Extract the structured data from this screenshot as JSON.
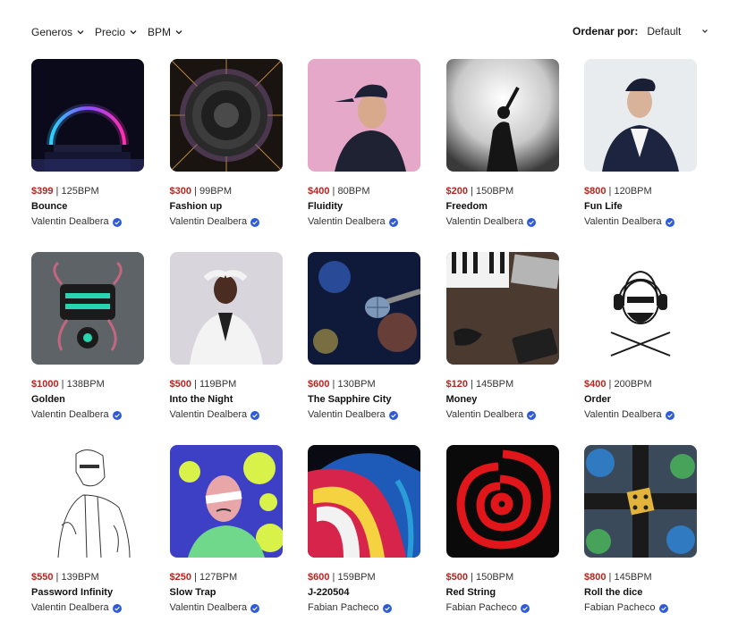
{
  "filters": [
    {
      "label": "Generos"
    },
    {
      "label": "Precio"
    },
    {
      "label": "BPM"
    }
  ],
  "sort": {
    "label": "Ordenar por:",
    "value": "Default"
  },
  "colors": {
    "price": "#b3261e",
    "verified": "#2d5bd7"
  },
  "beats": [
    {
      "price": "$399",
      "bpm": "125BPM",
      "title": "Bounce",
      "author": "Valentin Dealbera",
      "cover": "neon-arch"
    },
    {
      "price": "$300",
      "bpm": "99BPM",
      "title": "Fashion up",
      "author": "Valentin Dealbera",
      "cover": "speaker"
    },
    {
      "price": "$400",
      "bpm": "80BPM",
      "title": "Fluidity",
      "author": "Valentin Dealbera",
      "cover": "man-pink"
    },
    {
      "price": "$200",
      "bpm": "150BPM",
      "title": "Freedom",
      "author": "Valentin Dealbera",
      "cover": "singer-light"
    },
    {
      "price": "$800",
      "bpm": "120BPM",
      "title": "Fun Life",
      "author": "Valentin Dealbera",
      "cover": "man-cap-white"
    },
    {
      "price": "$1000",
      "bpm": "138BPM",
      "title": "Golden",
      "author": "Valentin Dealbera",
      "cover": "octopus-art"
    },
    {
      "price": "$500",
      "bpm": "119BPM",
      "title": "Into the Night",
      "author": "Valentin Dealbera",
      "cover": "man-white-suit"
    },
    {
      "price": "$600",
      "bpm": "130BPM",
      "title": "The Sapphire City",
      "author": "Valentin Dealbera",
      "cover": "microphone"
    },
    {
      "price": "$120",
      "bpm": "145BPM",
      "title": "Money",
      "author": "Valentin Dealbera",
      "cover": "keyboard-desk"
    },
    {
      "price": "$400",
      "bpm": "200BPM",
      "title": "Order",
      "author": "Valentin Dealbera",
      "cover": "dj-sketch"
    },
    {
      "price": "$550",
      "bpm": "139BPM",
      "title": "Password Infinity",
      "author": "Valentin Dealbera",
      "cover": "man-sketch"
    },
    {
      "price": "$250",
      "bpm": "127BPM",
      "title": "Slow Trap",
      "author": "Valentin Dealbera",
      "cover": "cartoon-man"
    },
    {
      "price": "$600",
      "bpm": "159BPM",
      "title": "J-220504",
      "author": "Fabian Pacheco",
      "cover": "paint-drip"
    },
    {
      "price": "$500",
      "bpm": "150BPM",
      "title": "Red String",
      "author": "Fabian Pacheco",
      "cover": "red-swirl"
    },
    {
      "price": "$800",
      "bpm": "145BPM",
      "title": "Roll the dice",
      "author": "Fabian Pacheco",
      "cover": "dice"
    }
  ]
}
